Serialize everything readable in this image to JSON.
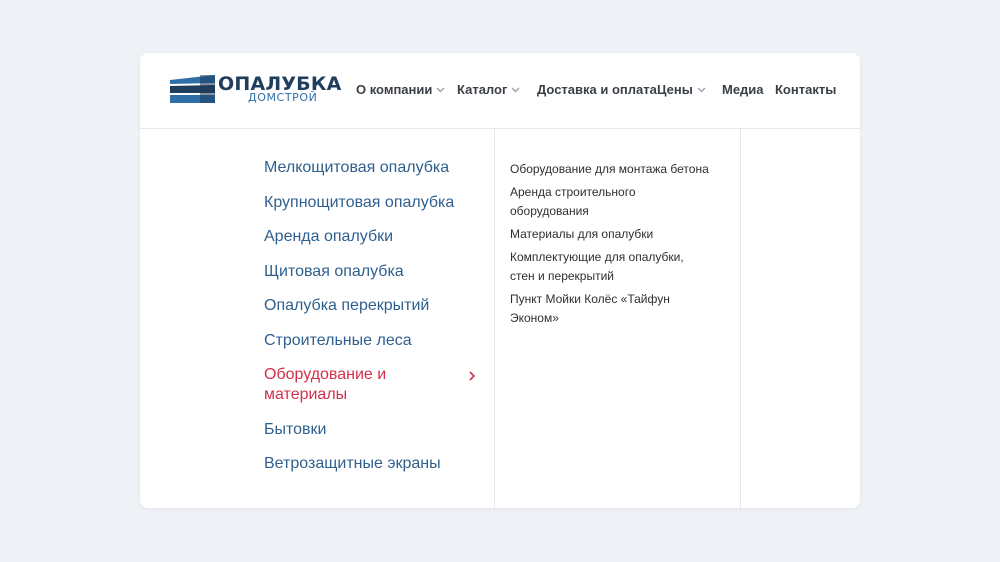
{
  "logo": {
    "title": "ОПАЛУБКА",
    "subtitle": "ДОМСТРОЙ",
    "colors": {
      "dark": "#1f3d5c",
      "blue": "#2e6fa8"
    }
  },
  "nav": [
    {
      "label": "О компании",
      "has_dropdown": true
    },
    {
      "label": "Каталог",
      "has_dropdown": true
    },
    {
      "label": "Доставка и оплата",
      "has_dropdown": false
    },
    {
      "label": "Цены",
      "has_dropdown": true
    },
    {
      "label": "Медиа",
      "has_dropdown": false
    },
    {
      "label": "Контакты",
      "has_dropdown": false
    }
  ],
  "categories": [
    {
      "label": "Мелкощитовая опалубка"
    },
    {
      "label": "Крупнощитовая опалубка"
    },
    {
      "label": "Аренда опалубки"
    },
    {
      "label": "Щитовая опалубка"
    },
    {
      "label": "Опалубка перекрытий"
    },
    {
      "label": "Строительные леса"
    },
    {
      "label": "Оборудование и материалы",
      "active": true,
      "icon": "chevron-right-icon"
    },
    {
      "label": "Бытовки"
    },
    {
      "label": "Ветрозащитные экраны"
    }
  ],
  "subcategories": [
    {
      "label": "Оборудование для монтажа бетона"
    },
    {
      "label": "Аренда строительного оборудования"
    },
    {
      "label": "Материалы для опалубки"
    },
    {
      "label": "Комплектующие для опалубки, стен и перекрытий"
    },
    {
      "label": "Пункт Мойки Колёс «Тайфун Эконом»"
    }
  ],
  "colors": {
    "link": "#2f5f8f",
    "active": "#d2304b",
    "text": "#2d2f33",
    "background": "#eef1f5"
  }
}
